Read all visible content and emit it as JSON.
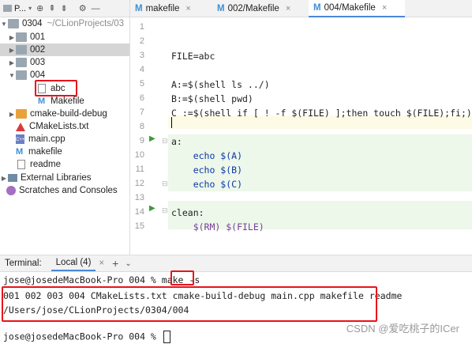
{
  "project_toolbar": {
    "label": "P...",
    "icons": [
      "target-icon",
      "collapse-icon",
      "expand-icon",
      "divider",
      "gear-icon",
      "minimize-icon"
    ]
  },
  "tree": {
    "root": {
      "name": "0304",
      "path": "~/CLionProjects/03"
    },
    "items": [
      {
        "name": "001"
      },
      {
        "name": "002"
      },
      {
        "name": "003"
      },
      {
        "name": "004"
      },
      {
        "name": "abc"
      },
      {
        "name": "Makefile"
      },
      {
        "name": "cmake-build-debug"
      },
      {
        "name": "CMakeLists.txt"
      },
      {
        "name": "main.cpp"
      },
      {
        "name": "makefile"
      },
      {
        "name": "readme"
      },
      {
        "name": "External Libraries"
      },
      {
        "name": "Scratches and Consoles"
      }
    ]
  },
  "tabs": [
    {
      "label": "makefile"
    },
    {
      "label": "002/Makefile"
    },
    {
      "label": "004/Makefile"
    }
  ],
  "editor": {
    "lines": [
      {
        "n": "1",
        "text": ""
      },
      {
        "n": "2",
        "text": ""
      },
      {
        "n": "3",
        "text": "FILE=abc"
      },
      {
        "n": "4",
        "text": ""
      },
      {
        "n": "5",
        "text": "A:=$(shell ls ../)"
      },
      {
        "n": "6",
        "text": "B:=$(shell pwd)"
      },
      {
        "n": "7",
        "text": "C :=$(shell if [ ! -f $(FILE) ];then touch $(FILE);fi;)"
      },
      {
        "n": "8",
        "text": ""
      },
      {
        "n": "9",
        "text": "a:"
      },
      {
        "n": "10",
        "text": "    echo $(A)"
      },
      {
        "n": "11",
        "text": "    echo $(B)"
      },
      {
        "n": "12",
        "text": "    echo $(C)"
      },
      {
        "n": "13",
        "text": ""
      },
      {
        "n": "14",
        "text": "clean:"
      },
      {
        "n": "15",
        "text": "    $(RM) $(FILE)"
      }
    ]
  },
  "terminal": {
    "label": "Terminal:",
    "tab": "Local (4)",
    "prompt1": "jose@josedeMacBook-Pro 004 % make ",
    "cmd_flag": "-s",
    "output1": "001 002 003 004 CMakeLists.txt cmake-build-debug main.cpp makefile readme",
    "output2": "/Users/jose/CLionProjects/0304/004",
    "prompt2": "jose@josedeMacBook-Pro 004 % "
  },
  "watermark": "CSDN @爱吃桃子的ICer",
  "colors": {
    "highlight_red": "#e8131b",
    "accent_blue": "#4a88d9",
    "run_green": "#3a9a3a"
  }
}
